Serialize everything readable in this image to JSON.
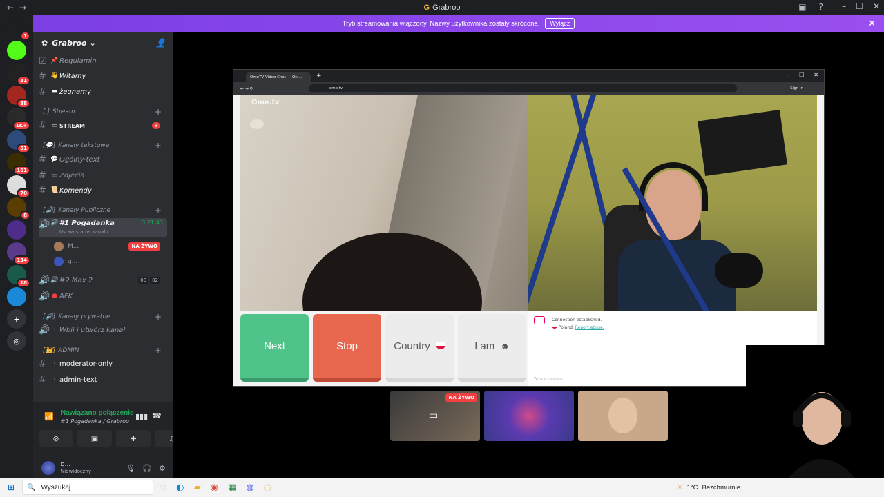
{
  "window": {
    "title": "Grabroo"
  },
  "banner": {
    "text": "Tryb streamowania włączony. Nazwy użytkownika zostały skrócone.",
    "button": "Wyłącz"
  },
  "servers": [
    {
      "name": "discord-home",
      "badge": "1",
      "color": "#1e1f22"
    },
    {
      "name": "kick",
      "badge": "",
      "color": "#53fc18"
    },
    {
      "name": "server-into",
      "badge": "31",
      "color": "#222"
    },
    {
      "name": "server-red",
      "badge": "88",
      "color": "#a3271f"
    },
    {
      "name": "server-palm",
      "badge": "1K+",
      "color": "#2a2a2a"
    },
    {
      "name": "server-v",
      "badge": "51",
      "color": "#2c4a7a"
    },
    {
      "name": "server-yellow",
      "badge": "161",
      "color": "#3a2d00"
    },
    {
      "name": "server-pirate",
      "badge": "70",
      "color": "#ddd"
    },
    {
      "name": "server-g",
      "badge": "8",
      "color": "#5a3d00"
    },
    {
      "name": "server-kight",
      "badge": "",
      "color": "#4e2c8a"
    },
    {
      "name": "server-134",
      "badge": "134",
      "color": "#5b3a8c"
    },
    {
      "name": "server-18",
      "badge": "18",
      "color": "#1a5a4a"
    },
    {
      "name": "server-a",
      "badge": "",
      "color": "#1a8ad8"
    }
  ],
  "guild": {
    "name": "Grabroo"
  },
  "channels": {
    "regulamin": "Regulamin",
    "witamy": "Witamy",
    "zegnamy": "żegnamy",
    "cat_stream": "Stream",
    "stream": "STREAM",
    "stream_badge": "8",
    "cat_text": "Kanały tekstowe",
    "ogolny": "Ogólny-text",
    "zdjecia": "Zdjecia",
    "komendy": "Komendy",
    "cat_public": "Kanały Publiczne",
    "pogadanka": "#1 Pogadanka",
    "pogadanka_status": "Ustaw status kanału",
    "pogadanka_time": "3:21:43",
    "user1": "M...",
    "user2": "g...",
    "live": "NA ŻYWO",
    "max2": "#2 Max 2",
    "max2_a": "00",
    "max2_b": "02",
    "afk": "AFK",
    "cat_private": "Kanały prywatne",
    "wbij": "Wbij i utwórz kanał",
    "cat_admin": "ADMIN",
    "moderator": "moderator-only",
    "admin_text": "admin-text"
  },
  "voice": {
    "status": "Nawiązano połączenie",
    "sub": "#1 Pogadanka / Grabroo"
  },
  "user": {
    "name": "g...",
    "status": "Niewidoczny"
  },
  "browser": {
    "tab": "OmeTV Video Chat — Onl...",
    "url": "ome.tv",
    "sign_in": "Sign in",
    "logo": "Ome.tv",
    "buttons": {
      "next": "Next",
      "stop": "Stop",
      "country": "Country",
      "iam": "I am"
    },
    "chat_line1": "Connection established.",
    "chat_line2": "Poland.",
    "report": "Report abuse.",
    "input_placeholder": "Write a message"
  },
  "thumbs": {
    "live": "NA ŻYWO"
  },
  "taskbar": {
    "search": "Wyszukaj",
    "weather_temp": "1°C",
    "weather_desc": "Bezchmurnie"
  }
}
